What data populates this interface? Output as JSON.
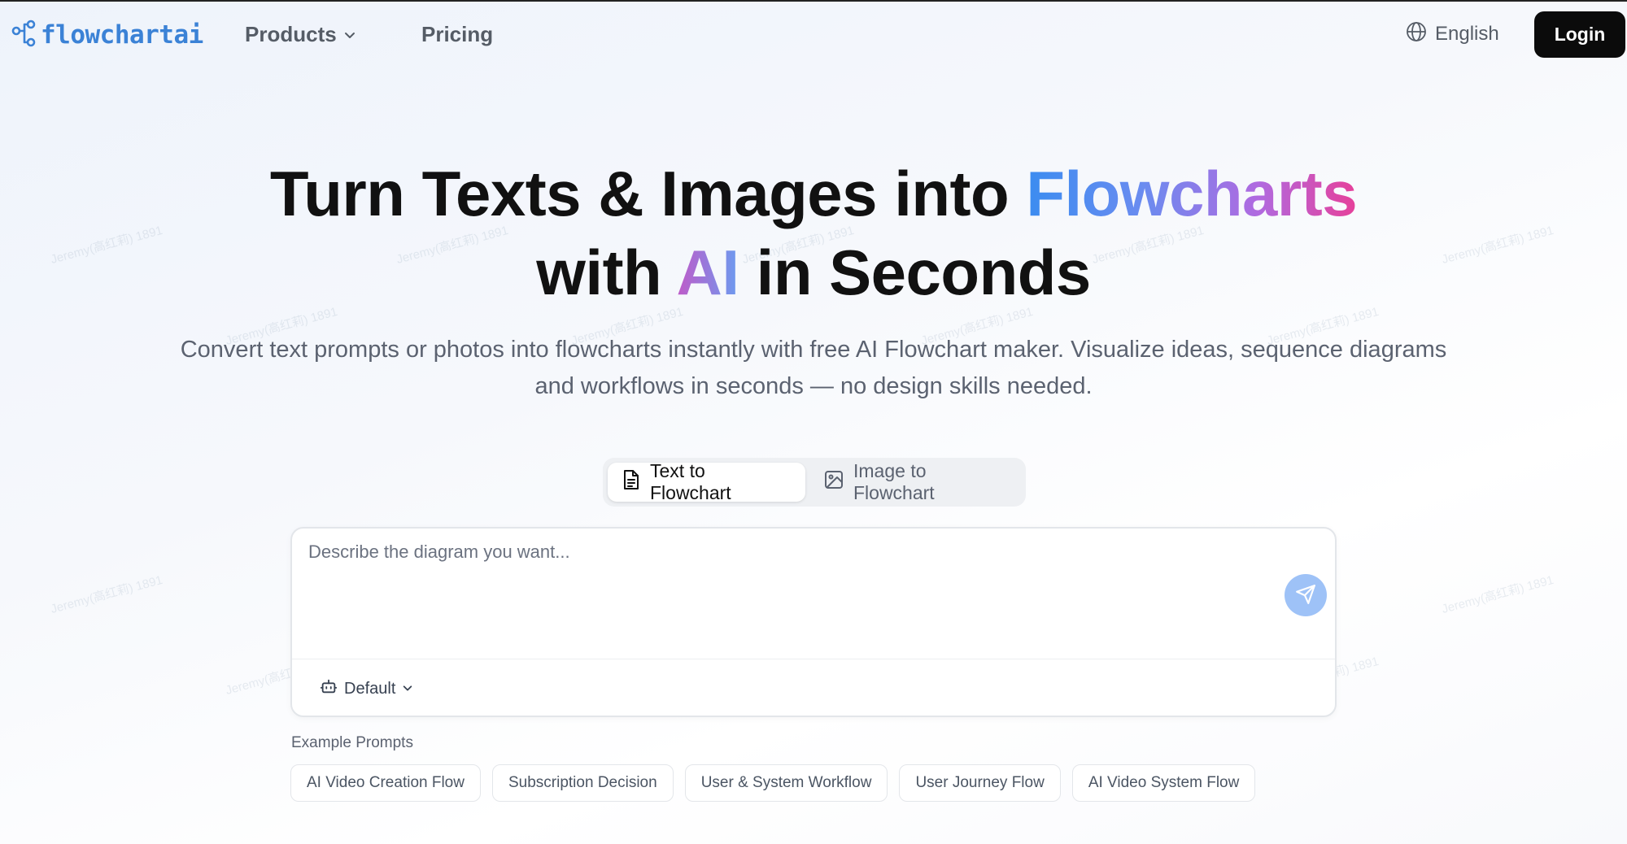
{
  "header": {
    "logo_text": "flowchartai",
    "nav": [
      {
        "label": "Products"
      },
      {
        "label": "Pricing"
      }
    ],
    "language": "English",
    "login_label": "Login"
  },
  "hero": {
    "title_part1": "Turn Texts & Images into ",
    "title_highlight1": "Flowcharts",
    "title_part2": "with ",
    "title_highlight2": "AI",
    "title_part3": " in Seconds",
    "subtitle_line1": "Convert text prompts or photos into flowcharts instantly with free AI Flowchart maker. Visualize ideas, sequence diagrams",
    "subtitle_line2": "and workflows in seconds — no design skills needed."
  },
  "tabs": [
    {
      "label": "Text to Flowchart",
      "active": true
    },
    {
      "label": "Image to Flowchart",
      "active": false
    }
  ],
  "prompt": {
    "placeholder": "Describe the diagram you want...",
    "value": "",
    "model": "Default"
  },
  "examples": {
    "label": "Example Prompts",
    "items": [
      "AI Video Creation Flow",
      "Subscription Decision",
      "User & System Workflow",
      "User Journey Flow",
      "AI Video System Flow"
    ]
  },
  "watermark_text": "Jeremy(高红莉) 1891",
  "colors": {
    "brand": "#3b82d6",
    "login_bg": "#0b0b0b",
    "send_button": "#9ec2f7",
    "gradient_start": "#3b8cf0",
    "gradient_end": "#e6409a"
  },
  "icons": {
    "logo": "flow-nodes-icon",
    "products_chevron": "chevron-down-icon",
    "language": "globe-icon",
    "text_tab": "document-icon",
    "image_tab": "image-icon",
    "send": "send-icon",
    "model": "robot-icon",
    "model_chevron": "chevron-down-icon"
  }
}
